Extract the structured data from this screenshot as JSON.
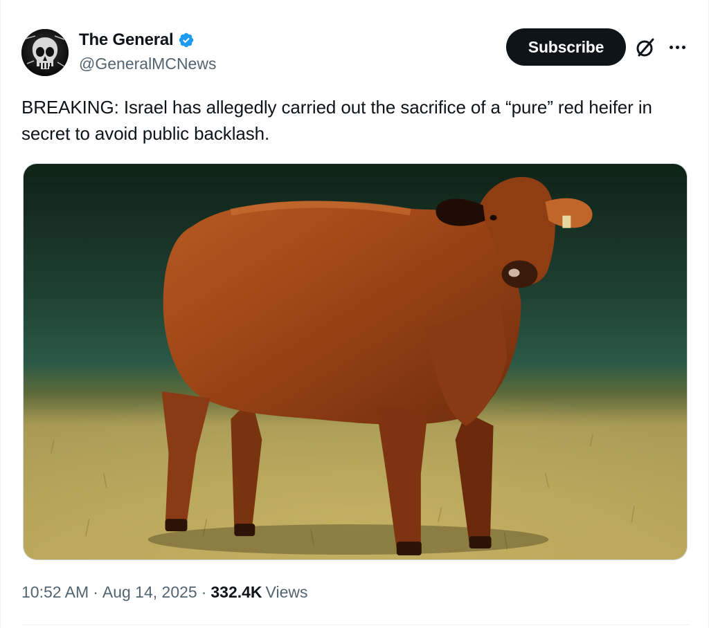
{
  "author": {
    "display_name": "The General",
    "handle": "@GeneralMCNews"
  },
  "header": {
    "subscribe_label": "Subscribe"
  },
  "tweet": {
    "text": "BREAKING: Israel has allegedly carried out the sacrifice of a “pure” red heifer in secret to avoid public backlash."
  },
  "meta": {
    "time": "10:52 AM",
    "separator": "·",
    "date": "Aug 14, 2025",
    "views_count": "332.4K",
    "views_label": "Views"
  },
  "icons": {
    "verified": "verified-badge-icon",
    "grok": "grok-icon",
    "more": "more-icon"
  },
  "colors": {
    "verified": "#1d9bf0",
    "text_primary": "#0f1419",
    "text_secondary": "#536471",
    "subscribe_bg": "#0f1419"
  }
}
